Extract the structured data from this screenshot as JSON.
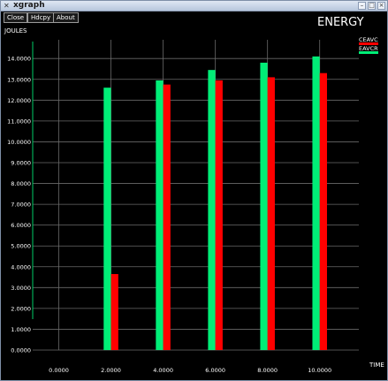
{
  "window": {
    "title": "xgraph",
    "buttons": {
      "close": "Close",
      "hdcpy": "Hdcpy",
      "about": "About"
    }
  },
  "chart_data": {
    "type": "bar",
    "title": "ENERGY",
    "ylabel": "JOULES",
    "xlabel": "TIME",
    "x": [
      2,
      4,
      6,
      8,
      10
    ],
    "xticks": [
      "0.0000",
      "2.0000",
      "4.0000",
      "6.0000",
      "8.0000",
      "10.0000"
    ],
    "yticks": [
      "0.0000",
      "1.0000",
      "2.0000",
      "3.0000",
      "4.0000",
      "5.0000",
      "6.0000",
      "7.0000",
      "8.0000",
      "9.0000",
      "10.0000",
      "11.0000",
      "12.0000",
      "13.0000",
      "14.0000"
    ],
    "xlim": [
      -1,
      11.5
    ],
    "ylim": [
      0,
      14.9
    ],
    "grid": true,
    "legend_position": "top-right",
    "series": [
      {
        "name": "EAVCR",
        "color": "#00ee77",
        "values": [
          12.6,
          12.95,
          13.45,
          13.8,
          14.1
        ]
      },
      {
        "name": "CEAVC",
        "color": "#ff0000",
        "values": [
          3.65,
          12.75,
          12.95,
          13.1,
          13.3
        ]
      }
    ]
  }
}
